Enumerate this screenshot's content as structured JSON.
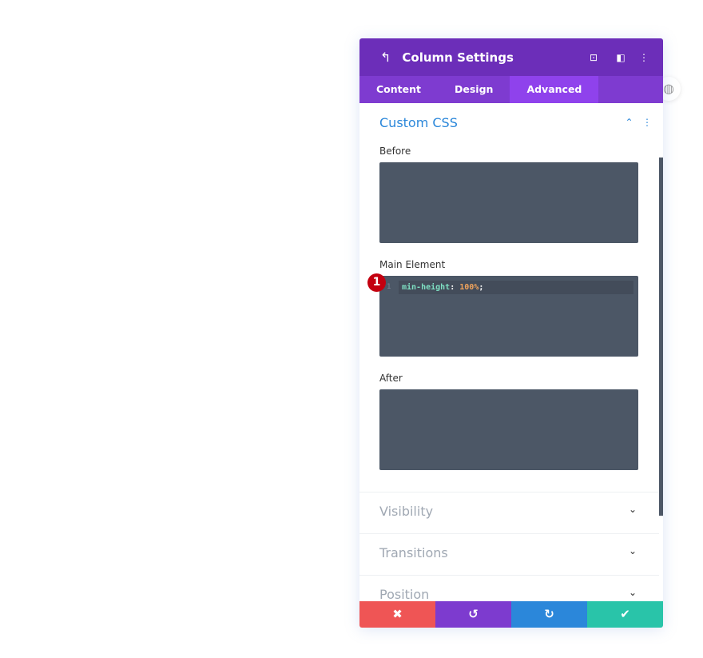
{
  "header": {
    "title": "Column Settings",
    "back_icon": "undo-arrow-icon",
    "icons": [
      "fullscreen-icon",
      "split-view-icon",
      "more-icon"
    ]
  },
  "tabs": [
    {
      "label": "Content"
    },
    {
      "label": "Design"
    },
    {
      "label": "Advanced",
      "active": true
    }
  ],
  "section": {
    "title": "Custom CSS",
    "expanded": true
  },
  "fields": [
    {
      "label": "Before",
      "code": ""
    },
    {
      "label": "Main Element",
      "line_number": "1",
      "property": "min-height",
      "colon": ": ",
      "value": "100%",
      "semicolon": ";"
    },
    {
      "label": "After",
      "code": ""
    }
  ],
  "annotation": "1",
  "collapsed_sections": [
    "Visibility",
    "Transitions",
    "Position"
  ],
  "footer": {
    "cancel": "✖",
    "undo": "↺",
    "redo": "↻",
    "save": "✔"
  },
  "colors": {
    "header": "#6c2eb9",
    "tabs": "#7e3bd0",
    "active_tab": "#8f42ec",
    "accent": "#2b87da",
    "cancel": "#ef5555",
    "undo": "#7d3bcf",
    "redo": "#2b87da",
    "save": "#29c4a9"
  }
}
